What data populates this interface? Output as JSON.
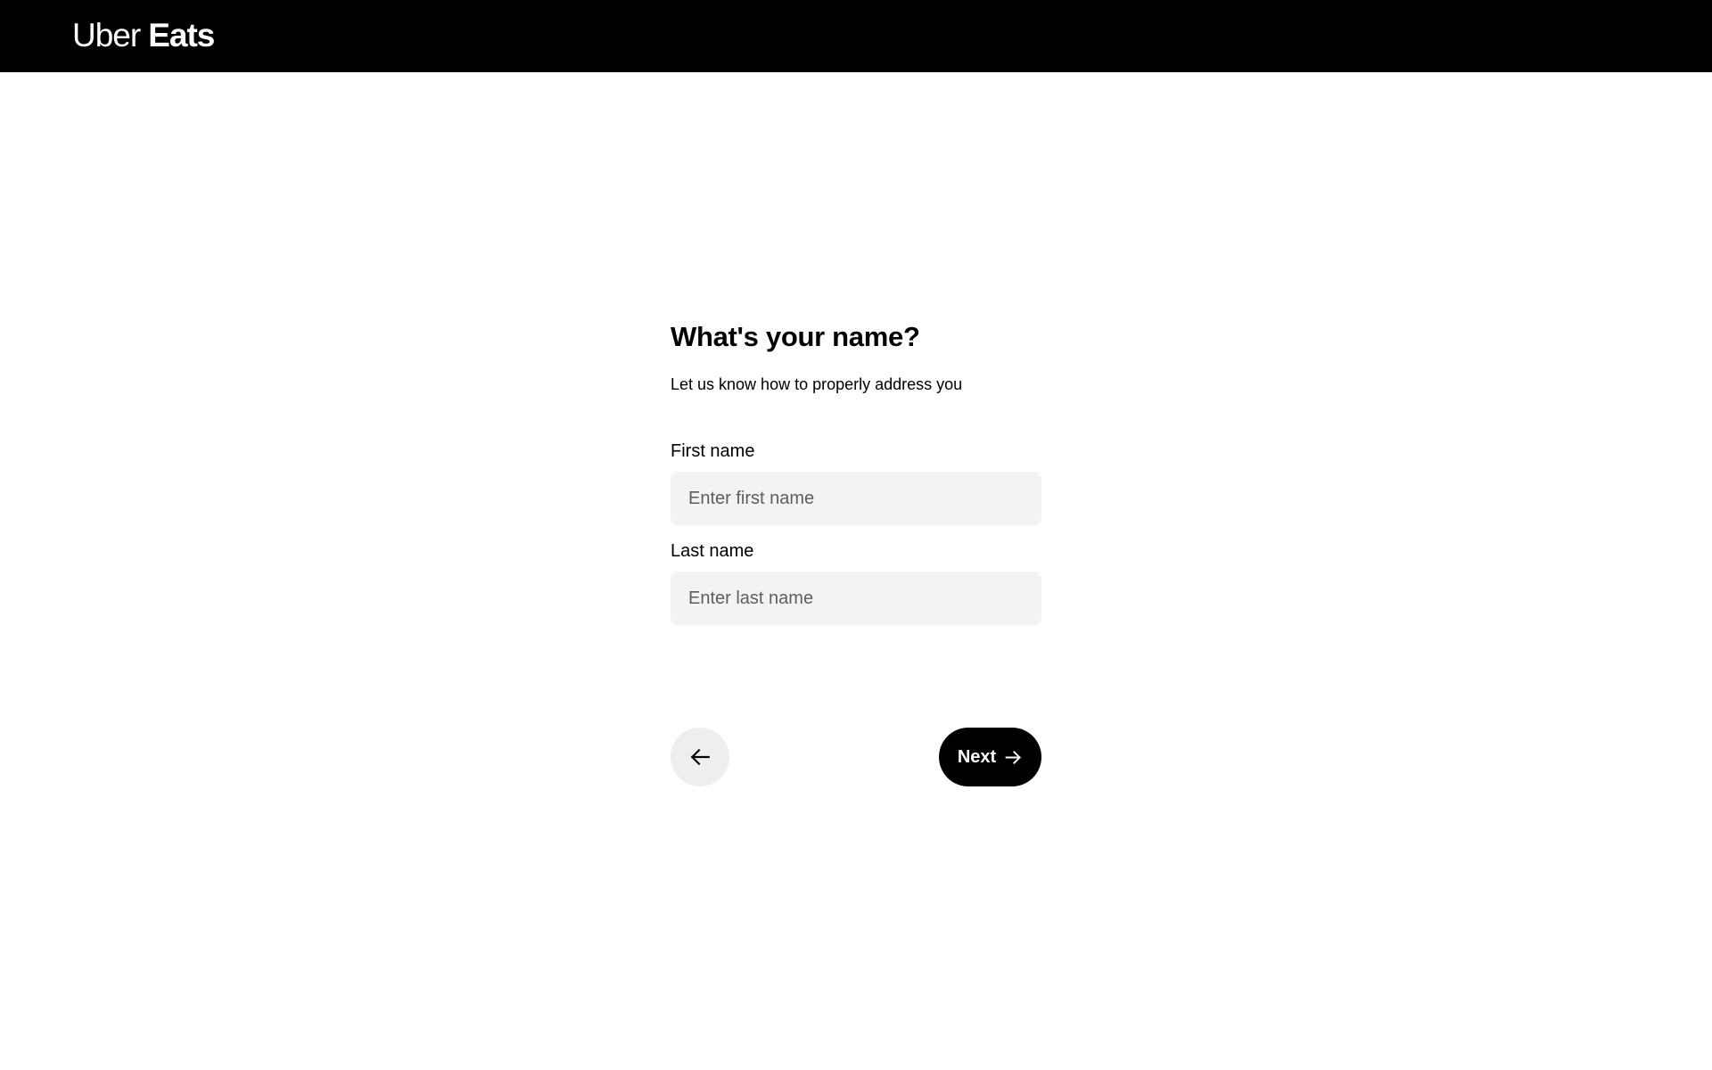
{
  "header": {
    "logo_primary": "Uber",
    "logo_secondary": "Eats",
    "background_color": "#000000"
  },
  "form": {
    "title": "What's your name?",
    "subtitle": "Let us know how to properly address you",
    "first_name": {
      "label": "First name",
      "placeholder": "Enter first name",
      "value": ""
    },
    "last_name": {
      "label": "Last name",
      "placeholder": "Enter last name",
      "value": ""
    }
  },
  "actions": {
    "back_icon": "arrow-left-icon",
    "next_label": "Next",
    "next_icon": "arrow-right-icon",
    "next_color": "#000000"
  }
}
